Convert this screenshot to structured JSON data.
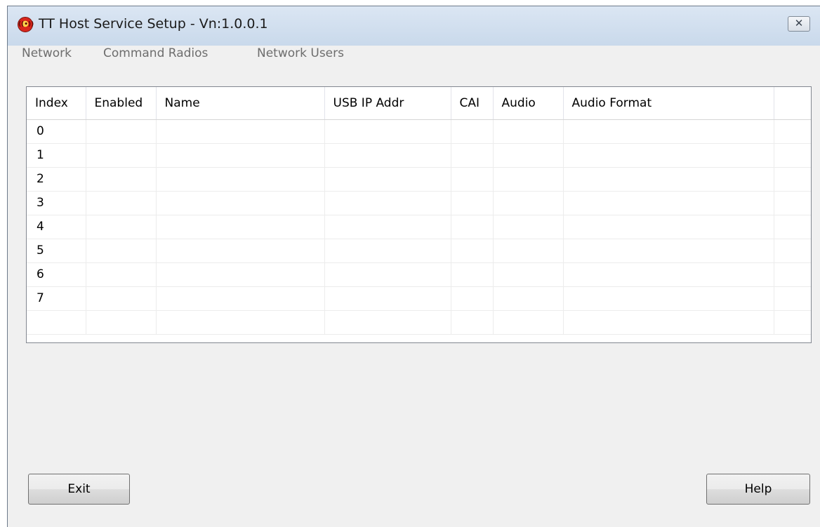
{
  "window": {
    "title": "TT Host Service Setup - Vn:1.0.0.1",
    "app_icon_glyph": "((•))",
    "close_glyph": "✕"
  },
  "menu": {
    "items": [
      "Network",
      "Command Radios",
      "Network Users"
    ]
  },
  "table": {
    "columns": [
      "Index",
      "Enabled",
      "Name",
      "USB IP Addr",
      "CAI",
      "Audio",
      "Audio Format",
      ""
    ],
    "rows": [
      [
        "0",
        "",
        "",
        "",
        "",
        "",
        "",
        ""
      ],
      [
        "1",
        "",
        "",
        "",
        "",
        "",
        "",
        ""
      ],
      [
        "2",
        "",
        "",
        "",
        "",
        "",
        "",
        ""
      ],
      [
        "3",
        "",
        "",
        "",
        "",
        "",
        "",
        ""
      ],
      [
        "4",
        "",
        "",
        "",
        "",
        "",
        "",
        ""
      ],
      [
        "5",
        "",
        "",
        "",
        "",
        "",
        "",
        ""
      ],
      [
        "6",
        "",
        "",
        "",
        "",
        "",
        "",
        ""
      ],
      [
        "7",
        "",
        "",
        "",
        "",
        "",
        "",
        ""
      ],
      [
        "",
        "",
        "",
        "",
        "",
        "",
        "",
        ""
      ]
    ]
  },
  "buttons": {
    "exit": "Exit",
    "help": "Help"
  },
  "colors": {
    "titlebar": "#c9d9eb",
    "window_bg": "#f0f0f0",
    "menu_text_disabled": "#6d6d6d"
  }
}
